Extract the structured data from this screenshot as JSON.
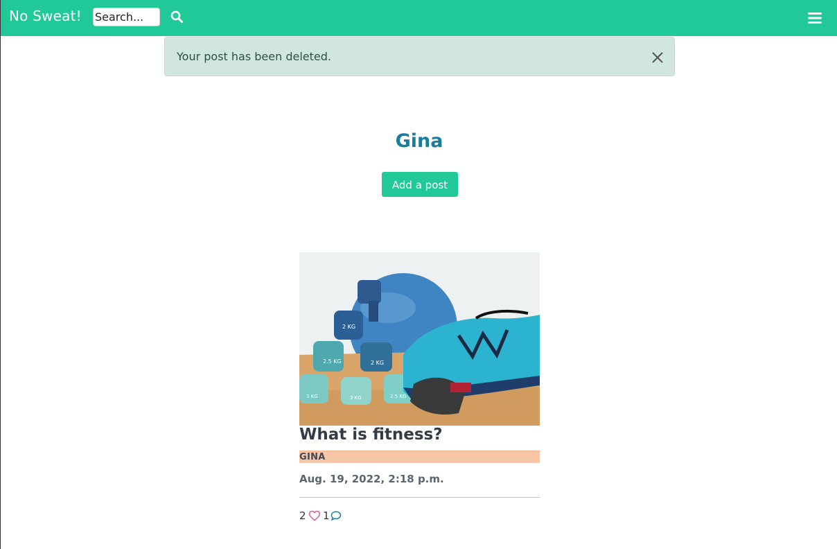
{
  "navbar": {
    "brand": "No Sweat!",
    "search_placeholder": "Search...",
    "search_icon": "search-icon",
    "menu_icon": "hamburger-menu-icon"
  },
  "alert": {
    "message": "Your post has been deleted.",
    "close_icon": "close-icon"
  },
  "profile": {
    "name": "Gina",
    "add_post_label": "Add a post"
  },
  "post": {
    "title": "What is fitness?",
    "author": "GINA",
    "date": "Aug. 19, 2022, 2:18 p.m.",
    "likes": "2",
    "comments": "1",
    "image_alt": "dumbbells-and-running-shoe-photo"
  },
  "colors": {
    "navbar": "#20c997",
    "accent_button": "#20c997",
    "profile_name": "#1a7d9a",
    "alert_bg": "#d1e7dd",
    "author_bar": "#f6c6a6",
    "like_icon": "#e0568a",
    "comment_icon": "#1a7d9a"
  }
}
